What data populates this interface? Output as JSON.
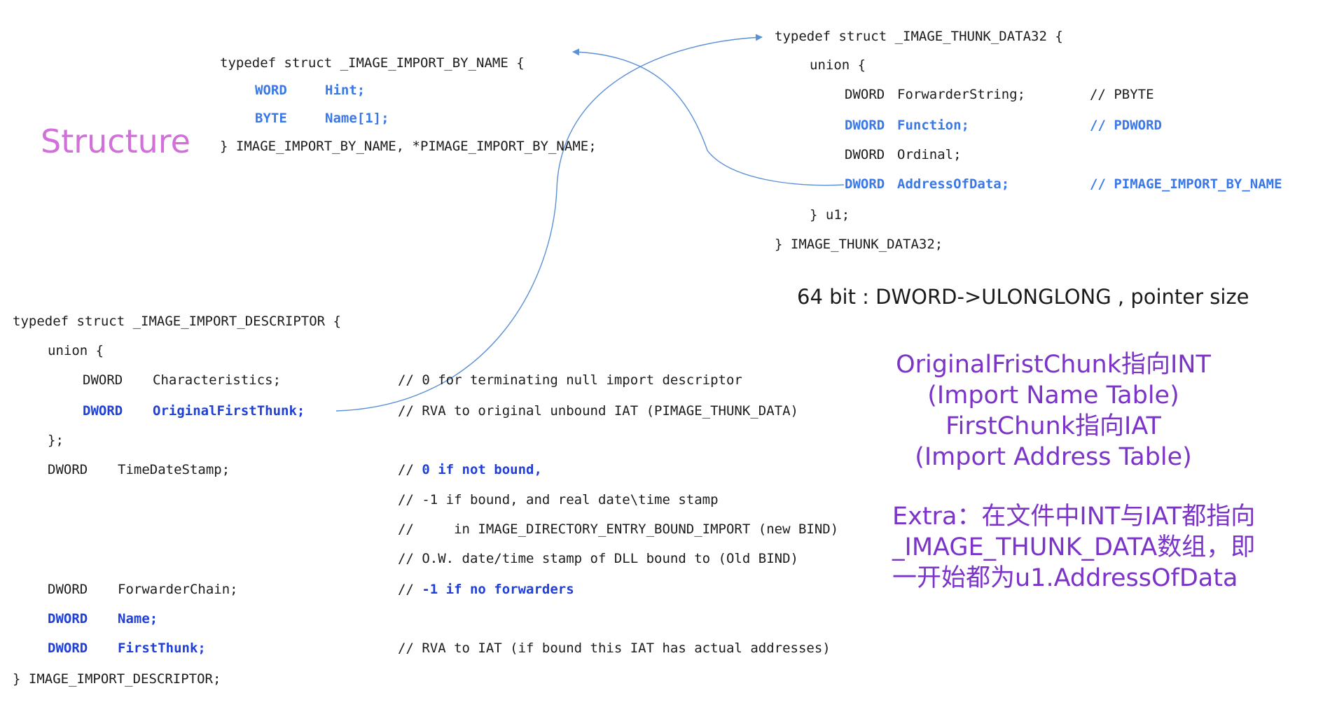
{
  "heading": "Structure",
  "import_by_name": {
    "line_open": "typedef struct _IMAGE_IMPORT_BY_NAME {",
    "field1_type": "WORD",
    "field1_name": "Hint;",
    "field2_type": "BYTE",
    "field2_name": "Name[1];",
    "line_close": "} IMAGE_IMPORT_BY_NAME, *PIMAGE_IMPORT_BY_NAME;"
  },
  "thunk_data": {
    "line_open": "typedef struct _IMAGE_THUNK_DATA32 {",
    "union_open": "union {",
    "rows": [
      {
        "type": "DWORD",
        "name": "ForwarderString;",
        "comment": "// PBYTE",
        "highlight": false
      },
      {
        "type": "DWORD",
        "name": "Function;",
        "comment": "// PDWORD",
        "highlight": true
      },
      {
        "type": "DWORD",
        "name": "Ordinal;",
        "comment": "",
        "highlight": false
      },
      {
        "type": "DWORD",
        "name": "AddressOfData;",
        "comment": "// PIMAGE_IMPORT_BY_NAME",
        "highlight": true
      }
    ],
    "union_close": "} u1;",
    "line_close": "} IMAGE_THUNK_DATA32;"
  },
  "note_64bit": "64 bit : DWORD->ULONGLONG , pointer size",
  "import_descriptor": {
    "line_open": "typedef struct _IMAGE_IMPORT_DESCRIPTOR {",
    "union_open": "union {",
    "union_rows": [
      {
        "type": "DWORD",
        "name": "Characteristics;",
        "comment": "// 0 for terminating null import descriptor",
        "highlight": false
      },
      {
        "type": "DWORD",
        "name": "OriginalFirstThunk;",
        "comment": "// RVA to original unbound IAT (PIMAGE_THUNK_DATA)",
        "highlight": true
      }
    ],
    "union_close": "};",
    "timestamp_type": "DWORD",
    "timestamp_name": "TimeDateStamp;",
    "timestamp_comment_prefix": "// ",
    "timestamp_comment_bold": "0 if not bound,",
    "comment_lines": [
      "// -1 if bound, and real date\\time stamp",
      "//     in IMAGE_DIRECTORY_ENTRY_BOUND_IMPORT (new BIND)",
      "// O.W. date/time stamp of DLL bound to (Old BIND)"
    ],
    "forwarder_type": "DWORD",
    "forwarder_name": "ForwarderChain;",
    "forwarder_comment_prefix": "// ",
    "forwarder_comment_bold": "-1 if no forwarders",
    "name_type": "DWORD",
    "name_name": "Name;",
    "firstthunk_type": "DWORD",
    "firstthunk_name": "FirstThunk;",
    "firstthunk_comment": "// RVA to IAT (if bound this IAT has actual addresses)",
    "line_close": "} IMAGE_IMPORT_DESCRIPTOR;"
  },
  "explanation": {
    "line1": "OriginalFristChunk指向INT",
    "line2": "(Import Name Table)",
    "line3": "FirstChunk指向IAT",
    "line4": "(Import Address Table)",
    "extra1": "Extra：在文件中INT与IAT都指向",
    "extra2": "_IMAGE_THUNK_DATA数组，即",
    "extra3": "一开始都为u1.AddressOfData"
  },
  "colors": {
    "code_text": "#1c1c1c",
    "keyword_blue": "#1f3fd6",
    "arrow_blue": "#5b8fd6",
    "title_pink": "#d070d8",
    "note_purple": "#7b33c8"
  }
}
